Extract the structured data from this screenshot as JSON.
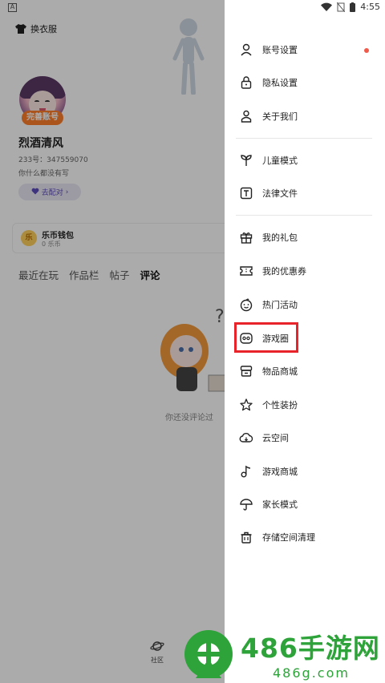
{
  "status_bar": {
    "left_badge": "A",
    "time": "4:55"
  },
  "profile": {
    "costume_label": "换衣服",
    "badge": "完善账号",
    "username": "烈酒清风",
    "user_id": "233号：347559070",
    "bio": "你什么都没有写",
    "match_label": "去配对",
    "wallet_title": "乐币钱包",
    "wallet_balance": "0 乐币",
    "coin_char": "乐"
  },
  "tabs": [
    {
      "label": "最近在玩"
    },
    {
      "label": "作品栏"
    },
    {
      "label": "帖子"
    },
    {
      "label": "评论",
      "active": true
    }
  ],
  "empty_text": "你还没评论过",
  "bottom_nav": {
    "community": "社区"
  },
  "drawer": {
    "items": [
      {
        "label": "账号设置",
        "icon": "user-icon",
        "dot": true
      },
      {
        "label": "隐私设置",
        "icon": "lock-icon"
      },
      {
        "label": "关于我们",
        "icon": "about-icon"
      },
      {
        "label": "儿童模式",
        "icon": "sprout-icon"
      },
      {
        "label": "法律文件",
        "icon": "document-icon"
      },
      {
        "label": "我的礼包",
        "icon": "gift-icon"
      },
      {
        "label": "我的优惠券",
        "icon": "coupon-icon"
      },
      {
        "label": "热门活动",
        "icon": "smile-icon"
      },
      {
        "label": "游戏圈",
        "icon": "gamepad-icon",
        "highlighted": true
      },
      {
        "label": "物品商城",
        "icon": "store-icon"
      },
      {
        "label": "个性装扮",
        "icon": "star-icon"
      },
      {
        "label": "云空间",
        "icon": "cloud-icon"
      },
      {
        "label": "游戏商城",
        "icon": "music-note-icon"
      },
      {
        "label": "家长模式",
        "icon": "umbrella-icon"
      },
      {
        "label": "存储空间清理",
        "icon": "trash-icon"
      }
    ]
  },
  "watermark": {
    "title": "486手游网",
    "url": "486g.com"
  },
  "colors": {
    "accent": "#ff7f2a",
    "highlight": "#e8242a",
    "watermark": "#2ea33a",
    "red_dot": "#f05a4a"
  }
}
